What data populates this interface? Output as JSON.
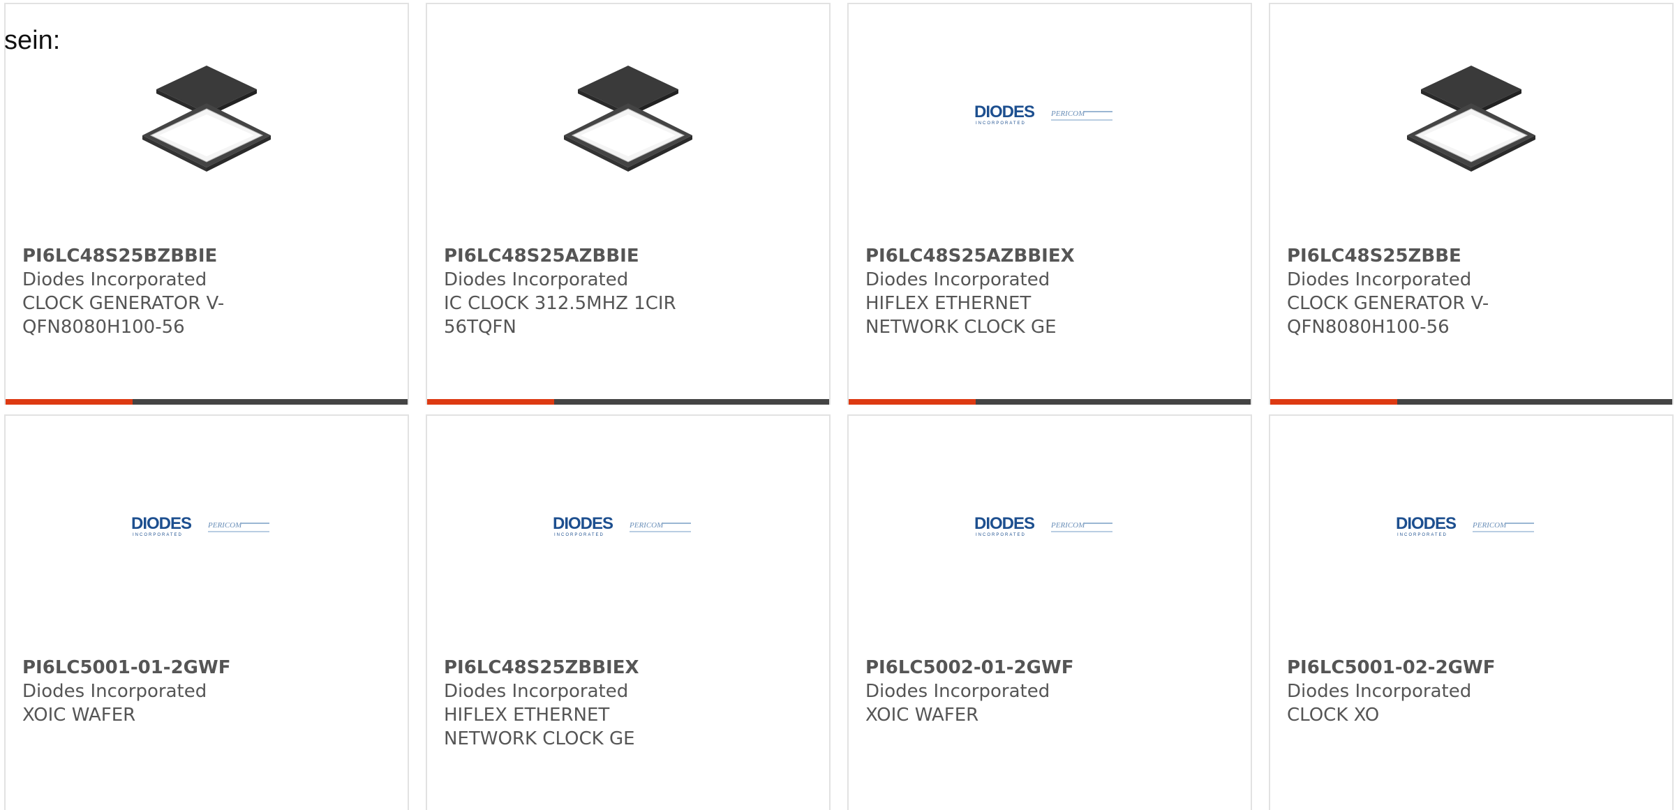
{
  "intro": {
    "text": "sein:"
  },
  "products": [
    {
      "part_number": "PI6LC48S25BZBBIE",
      "manufacturer": "Diodes Incorporated",
      "description": "CLOCK GENERATOR V-QFN8080H100-56",
      "image": "qfn-chip-image"
    },
    {
      "part_number": "PI6LC48S25AZBBIE",
      "manufacturer": "Diodes Incorporated",
      "description": "IC CLOCK 312.5MHZ 1CIR 56TQFN",
      "image": "qfn-chip-image"
    },
    {
      "part_number": "PI6LC48S25AZBBIEX",
      "manufacturer": "Diodes Incorporated",
      "description": "HIFLEX ETHERNET NETWORK CLOCK GE",
      "image": "diodes-pericom-logo"
    },
    {
      "part_number": "PI6LC48S25ZBBE",
      "manufacturer": "Diodes Incorporated",
      "description": "CLOCK GENERATOR V-QFN8080H100-56",
      "image": "qfn-chip-image"
    },
    {
      "part_number": "PI6LC5001-01-2GWF",
      "manufacturer": "Diodes Incorporated",
      "description": "XOIC WAFER",
      "image": "diodes-pericom-logo"
    },
    {
      "part_number": "PI6LC48S25ZBBIEX",
      "manufacturer": "Diodes Incorporated",
      "description": "HIFLEX ETHERNET NETWORK CLOCK GE",
      "image": "diodes-pericom-logo"
    },
    {
      "part_number": "PI6LC5002-01-2GWF",
      "manufacturer": "Diodes Incorporated",
      "description": "XOIC WAFER",
      "image": "diodes-pericom-logo"
    },
    {
      "part_number": "PI6LC5001-02-2GWF",
      "manufacturer": "Diodes Incorporated",
      "description": "CLOCK XO",
      "image": "diodes-pericom-logo"
    }
  ],
  "logo": {
    "brand": "DIODES",
    "sub": "INCORPORATED",
    "partner": "PERICOM"
  },
  "colors": {
    "accent": "#dd3a12",
    "bar": "#444444",
    "text": "#555555",
    "border": "#e2e2e2",
    "logo_blue": "#1d4f8f"
  }
}
